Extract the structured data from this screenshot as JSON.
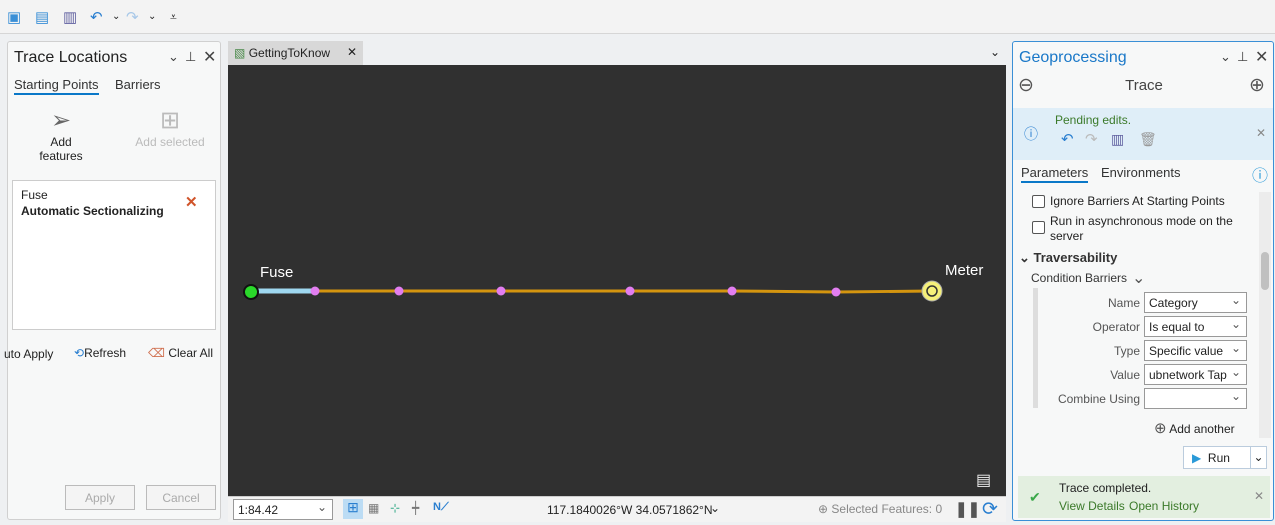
{
  "toolbar": {
    "icons": [
      "new-project-icon",
      "open-project-icon",
      "save-project-icon",
      "undo-icon",
      "redo-icon",
      "customize-icon"
    ]
  },
  "trace_locations": {
    "title": "Trace Locations",
    "tabs": [
      {
        "label": "Starting Points",
        "active": true
      },
      {
        "label": "Barriers",
        "active": false
      }
    ],
    "add_features": "Add features",
    "add_selected": "Add selected",
    "item": {
      "layer": "Fuse",
      "name": "Automatic Sectionalizing"
    },
    "auto_apply": "uto Apply",
    "refresh": "Refresh",
    "clear_all": "Clear All",
    "apply": "Apply",
    "cancel": "Cancel"
  },
  "map": {
    "tab": "GettingToKnow",
    "start_label": "Fuse",
    "end_label": "Meter",
    "line_color": "#d4950f",
    "vertex_color": "#e27ef0",
    "scale": "1:84.42",
    "coordinates": "117.1840026°W 34.0571862°N",
    "selected_features": "Selected Features: 0"
  },
  "geoprocessing": {
    "title": "Geoprocessing",
    "tool": "Trace",
    "pending": "Pending edits.",
    "tabs": [
      {
        "label": "Parameters",
        "active": true
      },
      {
        "label": "Environments",
        "active": false
      }
    ],
    "options": [
      {
        "label": "Ignore Barriers At Starting Points",
        "checked": false
      },
      {
        "label": "Run in asynchronous mode on the server",
        "checked": false
      }
    ],
    "section": "Traversability",
    "condition_barriers": "Condition Barriers",
    "fields": [
      {
        "label": "Name",
        "value": "Category"
      },
      {
        "label": "Operator",
        "value": "Is equal to"
      },
      {
        "label": "Type",
        "value": "Specific value"
      },
      {
        "label": "Value",
        "value": "ubnetwork Tap"
      },
      {
        "label": "Combine Using",
        "value": ""
      }
    ],
    "add_another": "Add another",
    "run": "Run",
    "status": "Trace completed.",
    "view_details": "View Details",
    "open_history": "Open History"
  }
}
